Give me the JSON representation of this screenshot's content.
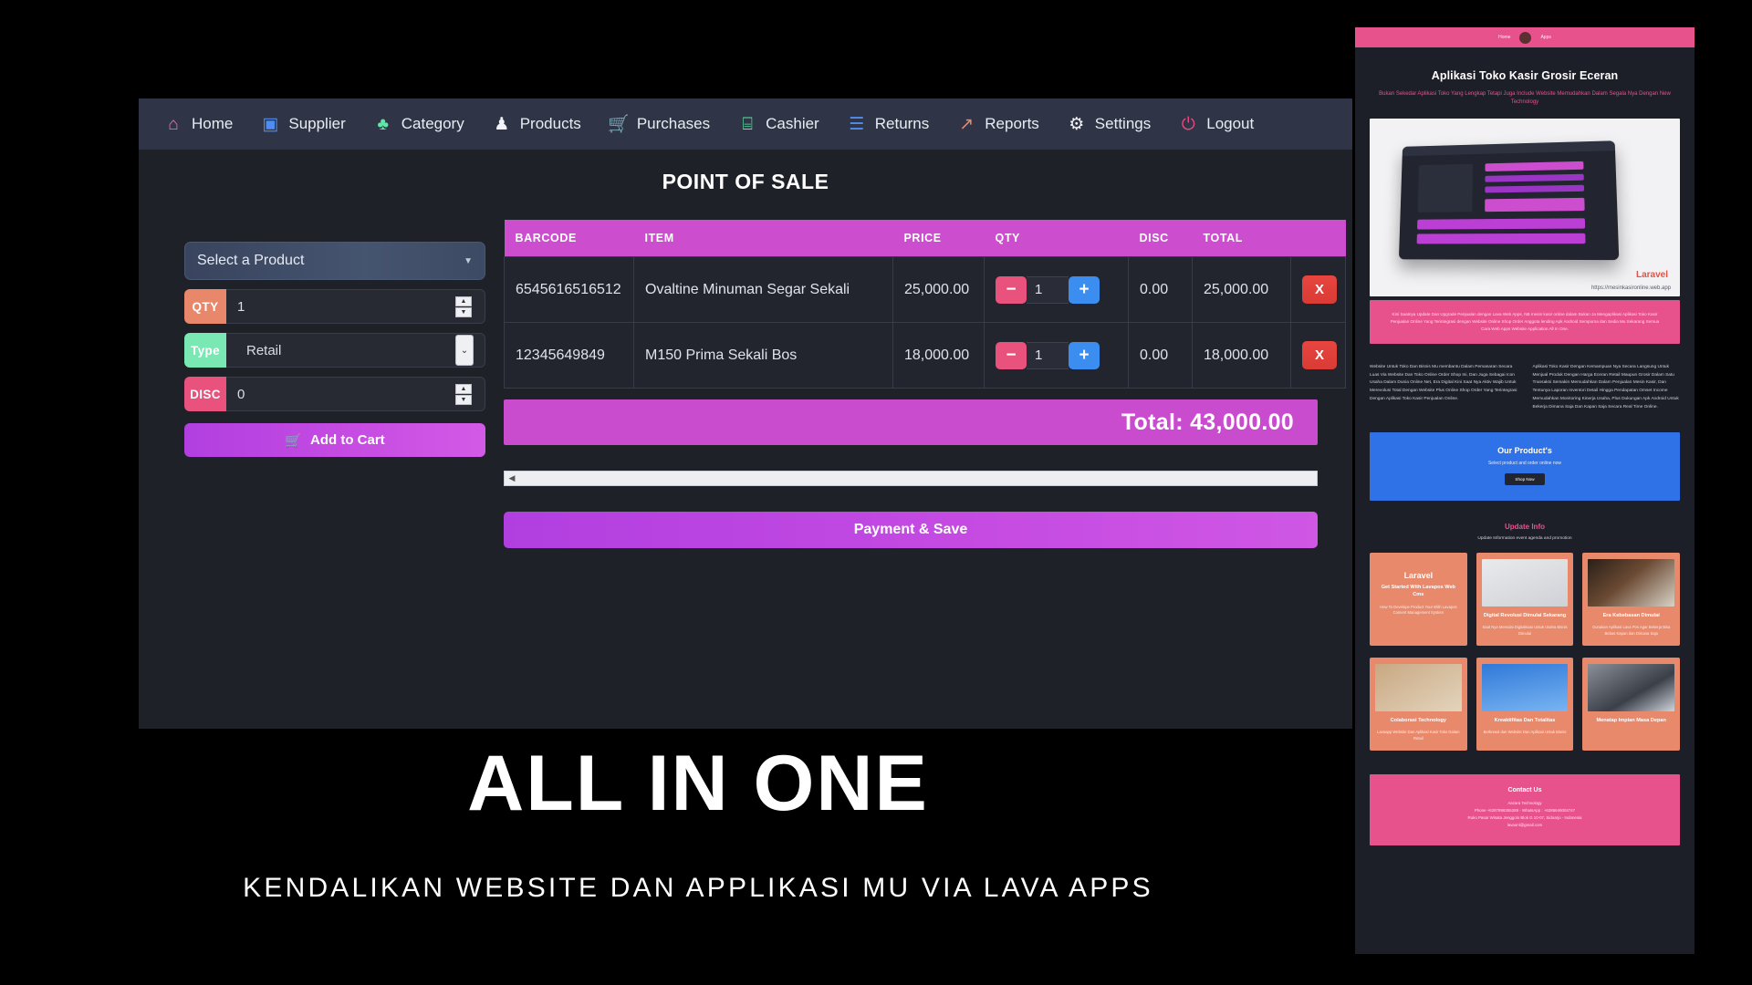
{
  "navbar": {
    "items": [
      {
        "label": "Home",
        "icon": "home-icon",
        "glyph": "⌂",
        "color": "#e87ab8"
      },
      {
        "label": "Supplier",
        "icon": "truck-icon",
        "glyph": "▣",
        "color": "#4f8ef0"
      },
      {
        "label": "Category",
        "icon": "tag-icon",
        "glyph": "♣",
        "color": "#5de8a8"
      },
      {
        "label": "Products",
        "icon": "shirt-icon",
        "glyph": "♟",
        "color": "#f2f4f8"
      },
      {
        "label": "Purchases",
        "icon": "cart-icon",
        "glyph": "🛒",
        "color": "#e8487f"
      },
      {
        "label": "Cashier",
        "icon": "register-icon",
        "glyph": "⌸",
        "color": "#5de8a8"
      },
      {
        "label": "Returns",
        "icon": "clipboard-icon",
        "glyph": "☰",
        "color": "#4f8ef0"
      },
      {
        "label": "Reports",
        "icon": "chart-icon",
        "glyph": "↗",
        "color": "#e8896c"
      },
      {
        "label": "Settings",
        "icon": "gear-icon",
        "glyph": "⚙",
        "color": "#f2f4f8"
      },
      {
        "label": "Logout",
        "icon": "power-icon",
        "glyph": "⏻",
        "color": "#e8487f"
      }
    ]
  },
  "page": {
    "title": "POINT OF SALE"
  },
  "form": {
    "select_product": {
      "label": "Select a Product",
      "caret": "▼"
    },
    "qty": {
      "label": "QTY",
      "value": "1"
    },
    "type": {
      "label": "Type",
      "value": "Retail",
      "caret": "⌄"
    },
    "disc": {
      "label": "DISC",
      "value": "0"
    },
    "add_to_cart": {
      "label": "Add to Cart",
      "icon_glyph": "🛒"
    },
    "spinner_up": "▲",
    "spinner_down": "▼"
  },
  "cart": {
    "columns": [
      "BARCODE",
      "ITEM",
      "PRICE",
      "QTY",
      "DISC",
      "TOTAL",
      ""
    ],
    "rows": [
      {
        "barcode": "6545616516512",
        "item": "Ovaltine Minuman Segar Sekali",
        "price": "25,000.00",
        "qty": "1",
        "disc": "0.00",
        "total": "25,000.00",
        "minus": "−",
        "plus": "+",
        "remove": "X"
      },
      {
        "barcode": "12345649849",
        "item": "M150 Prima Sekali Bos",
        "price": "18,000.00",
        "qty": "1",
        "disc": "0.00",
        "total": "18,000.00",
        "minus": "−",
        "plus": "+",
        "remove": "X"
      }
    ],
    "total_label": "Total: 43,000.00",
    "scroll_left": "◀",
    "payment_button": "Payment & Save"
  },
  "promo": {
    "topbar": {
      "left": "Home",
      "right": "Apps"
    },
    "heading": "Aplikasi Toko Kasir Grosir Eceran",
    "subheading": "Bukan Sekedar Aplikasi Toko Yang Lengkap Tetapi Juga Include Website Memudahkan Dalam Segala Nya Dengan New Technology",
    "hero": {
      "brand": "Laravel",
      "url": "https://mesinkasironline.web.app"
    },
    "pink_paragraph": "Kini Saatnya Update Dan Upgrade Penjualan dengan Lava Web Apps, NB mesin kasir online dalam Bukan Ja Mengaplikasi Aplikasi Toko Kasir Penjualan Online Yang Terintegrasi dengan Website Online Shop Order Anggota lending Apk Android Sempurna dan Sedia Mu Sekarang Semua Cara Web Apps Website Application All In One.",
    "col_left": "Website Untuk Toko Dan Bisnis Mu membantu Dalam Pemasaran Secara Luas Via Website Dan Toko Online Order Shop Ini, Dan Juga Sebagai Icon Usaha Dalam Dunia Online Net, Era Digital Kini Saat Nya Aktiv Wajib Untuk Merevolusi Total Dengan Website Plus Online Shop Order Yang Terintegrasi Dengan Aplikasi Toko Kasir Penjualan Online.",
    "col_right": "Aplikasi Toko Kasir Dengan Kemampuan Nya Secara Langsung Untuk Menjual Produk Dengan Harga Eceran Retail Maupun Grosir Dalam Satu Transaksi Semakin Memudahkan Dalam Penjualan Mesin Kasir, Dan Tentunya Laporan Inventori Detail Hingga Pendapatan Omset Income Memudahkan Monitoring Kinerja Usaha, Plus Dukungan Apk Android Untuk Bekerja Dimana Saja Dan Kapan Saja Secara Real Time Online.",
    "products": {
      "title": "Our Product's",
      "subtitle": "Select product and order online now",
      "button": "Shop Now"
    },
    "update": {
      "title": "Update Info",
      "subtitle": "Update Information event agenda and promotion"
    },
    "cards": [
      {
        "title": "Get Started With Lavapos Web Cms",
        "desc": "How To Develope Product Your With Lavapos Content Management System",
        "brand": "Laravel",
        "image": "laravel-logo-image"
      },
      {
        "title": "Digital Revolusi Dimulai Sekarang",
        "desc": "Saat Nya Memulai Digitalisasi Untuk Usaha Bisnis Dimulai",
        "image": "desk-gadgets-image"
      },
      {
        "title": "Era Kebebasan Dimulai",
        "desc": "Gunakan Aplikasi Lava Pos Agar Bekerja Bisa Bebas Kapan dan Dimana Saja",
        "image": "man-portrait-image"
      },
      {
        "title": "Colaborasi Technology",
        "desc": "Lavaapp Website Dan Aplikasi Kasir Toko Dalam Retail",
        "image": "technology-letters-image"
      },
      {
        "title": "Kreaktifitas Dan Totalitas",
        "desc": "Berkreasi dan Website Dan Aplikasi Untuk Bisnis",
        "image": "lightbulbs-image"
      },
      {
        "title": "Menatap Impian Masa Depan",
        "desc": "",
        "image": "vr-headset-image"
      }
    ],
    "contact": {
      "title": "Contact Us",
      "lines": "Aazara Technology\nPhone +6287898355289 - WhatsApp : +6285646004747\nRuko Pasar Wisata Jenggolo Blok G 10-07, Sidoarjo - Indonesia\nlavaonl@gmail.com"
    }
  },
  "banner": {
    "headline": "ALL IN ONE",
    "subline": "KENDALIKAN WEBSITE DAN APPLIKASI MU VIA LAVA APPS"
  }
}
